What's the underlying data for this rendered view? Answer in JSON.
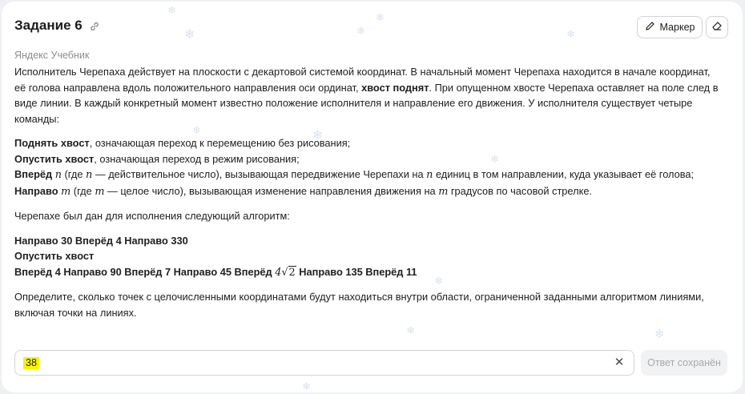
{
  "task": {
    "title": "Задание 6",
    "source": "Яндекс Учебник"
  },
  "toolbar": {
    "marker_label": "Маркер",
    "icons": [
      "pencil-icon",
      "eraser-icon",
      "link-icon"
    ]
  },
  "content": {
    "intro": [
      "Исполнитель Черепаха действует на плоскости с декартовой системой координат. В начальный момент Черепаха находится в начале координат, её голова направлена вдоль положительного направления оси ординат, ",
      "хвост поднят",
      ". При опущенном хвосте Черепаха оставляет на поле след в виде линии. В каждый конкретный момент известно положение исполнителя и направление его движения. У исполнителя существует четыре команды:"
    ],
    "commands": {
      "lift_name": "Поднять хвост",
      "lift_desc": ", означающая переход к перемещению без рисования;",
      "lower_name": "Опустить хвост",
      "lower_desc": ", означающая переход в режим рисования;",
      "forward_name": "Вперёд",
      "forward_var": "n",
      "forward_where_pre": " (где ",
      "forward_where_post": " — действительное число), вызывающая передвижение Черепахи на ",
      "forward_tail": " единиц в том направлении, куда указывает её голова;",
      "right_name": "Направо",
      "right_var": "m",
      "right_where_pre": " (где ",
      "right_where_post": " — целое число), вызывающая изменение направления движения на ",
      "right_tail": " градусов по часовой стрелке."
    },
    "algo_intro": "Черепахе был дан для исполнения следующий алгоритм:",
    "algo_line1": "Направо 30 Вперёд 4 Направо 330",
    "algo_line2": "Опустить хвост",
    "algo_line3_pre": "Вперёд 4 Направо 90 Вперёд 7 Направо 45 Вперёд ",
    "algo_line3_coef": "4",
    "algo_line3_root": "2",
    "algo_line3_post": " Направо 135 Вперёд 11",
    "question": "Определите, сколько точек с целочисленными координатами будут находиться внутри области, ограниченной заданными алгоритмом линиями, включая точки на линиях."
  },
  "answer": {
    "value": "38",
    "saved_label": "Ответ сохранён"
  },
  "colors": {
    "highlight": "#fbf200",
    "background": "#eef0f3",
    "card": "#ffffff"
  }
}
